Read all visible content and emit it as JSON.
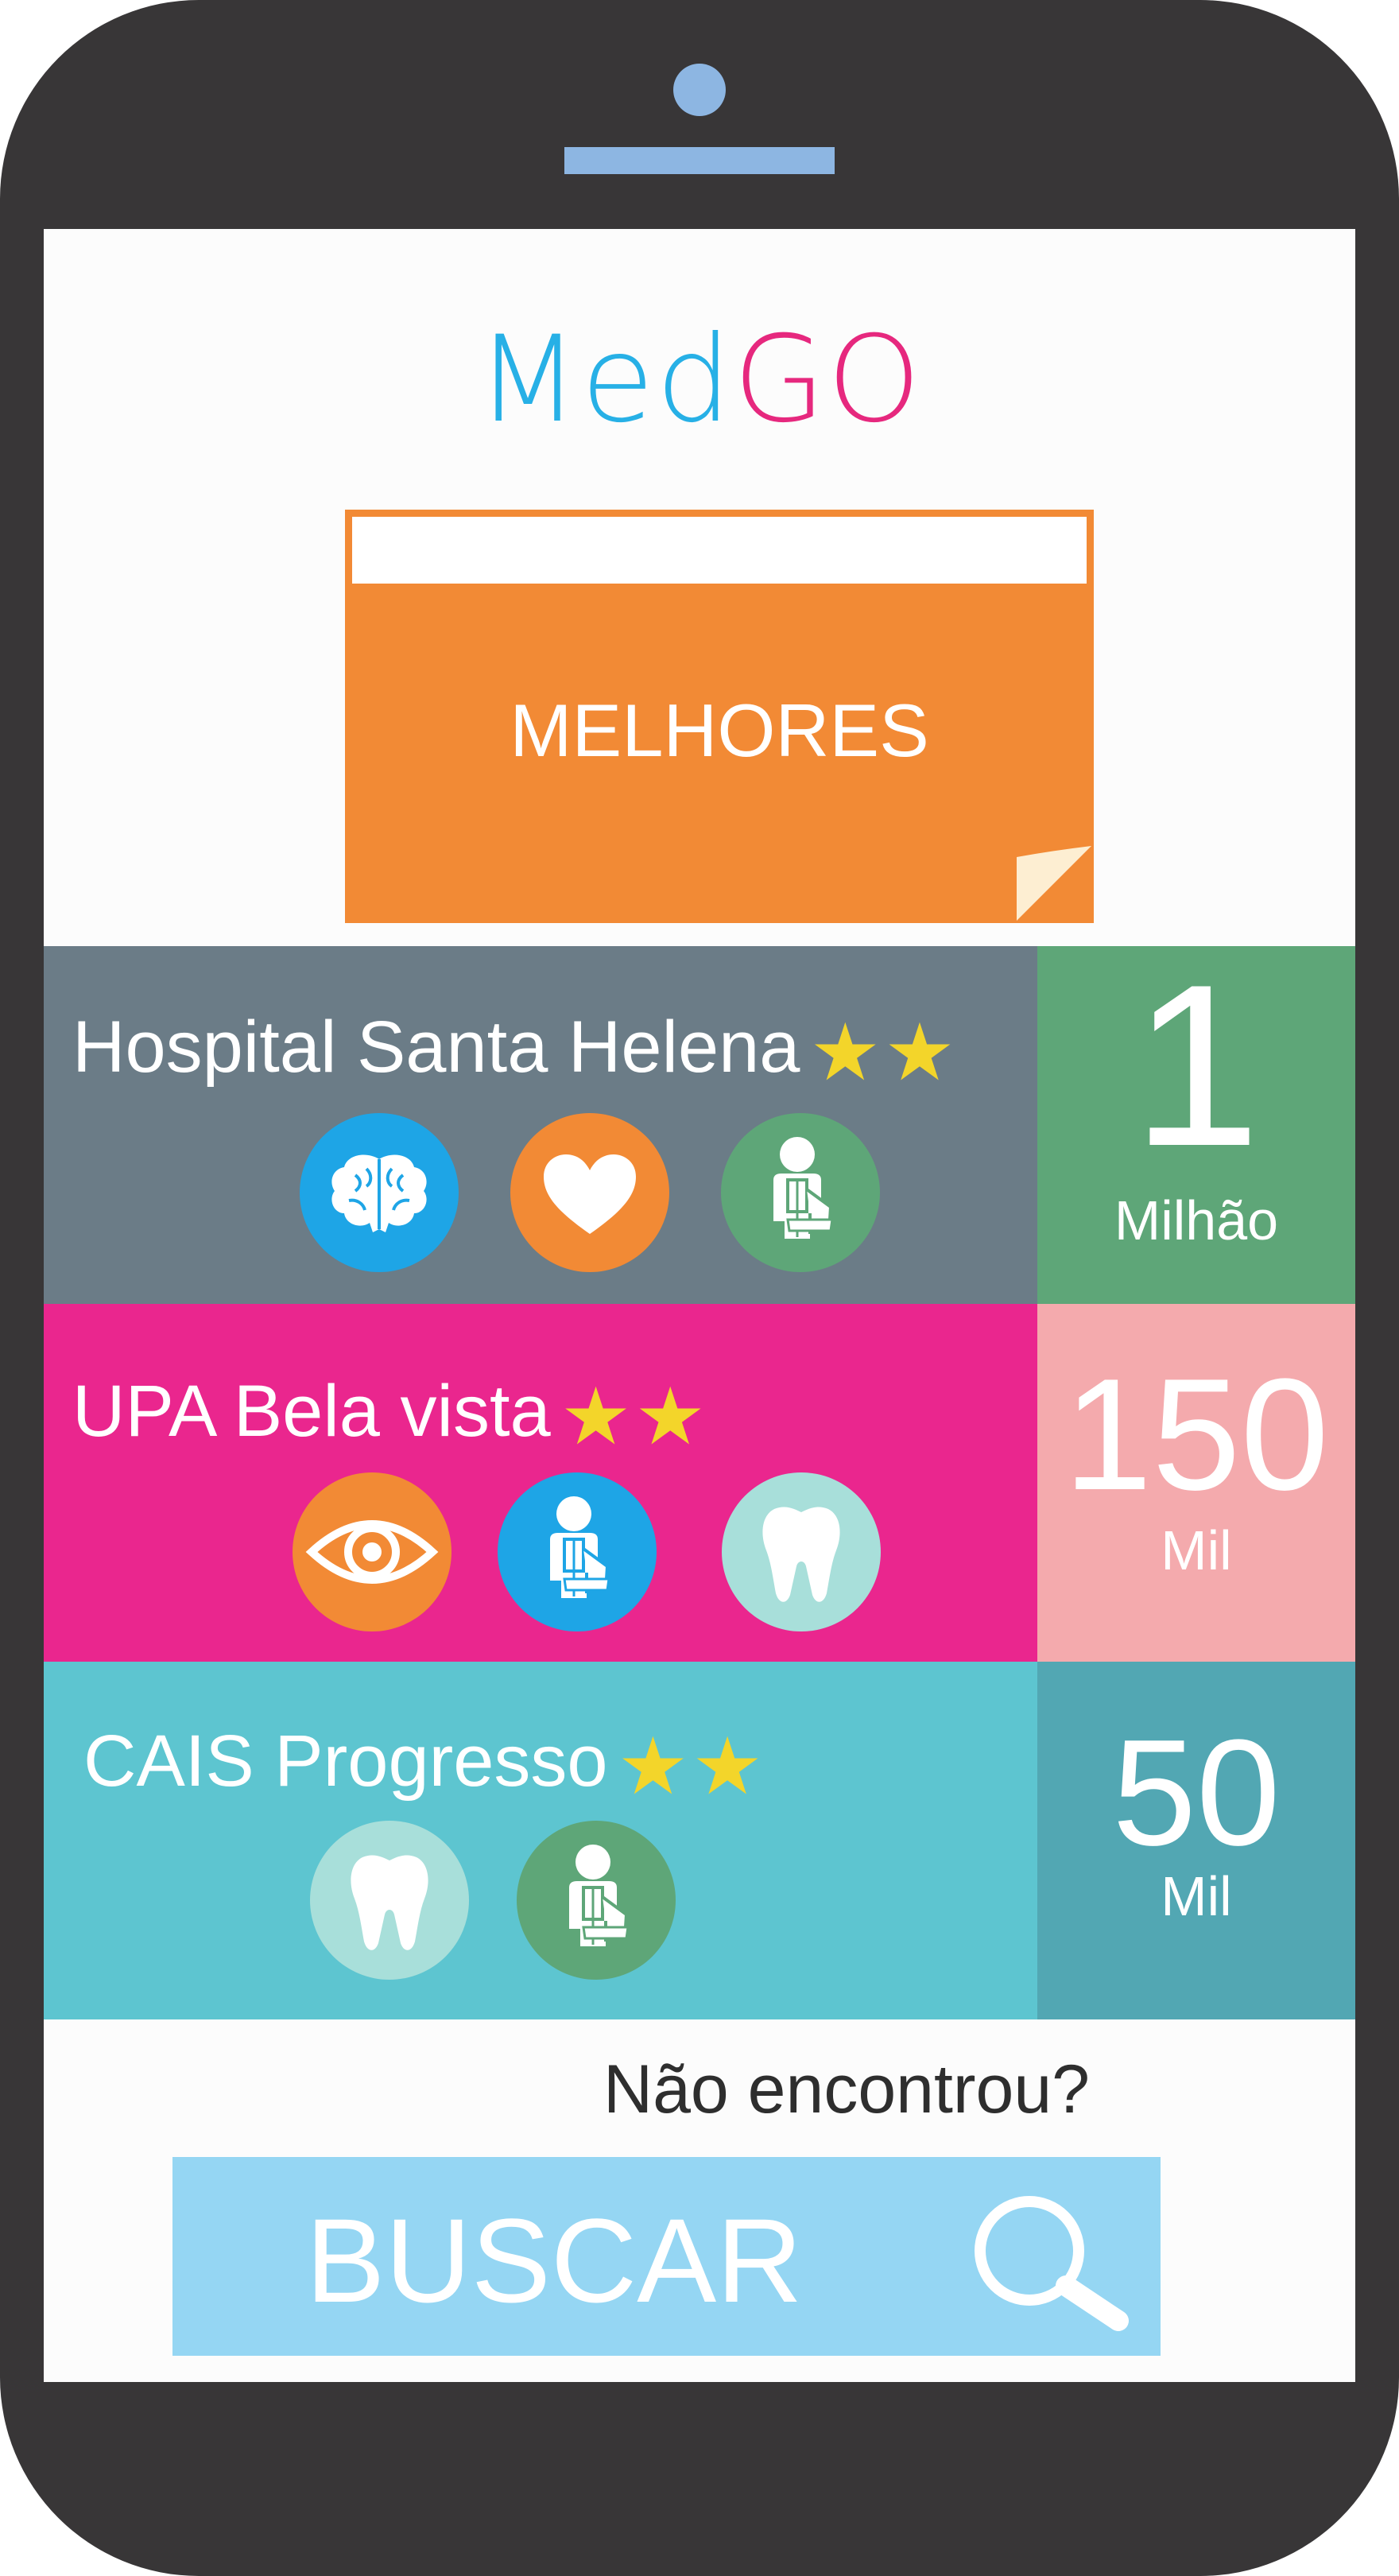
{
  "app": {
    "logo_part1": "Med",
    "logo_part2": "GO"
  },
  "header": {
    "title": "MELHORES"
  },
  "colors": {
    "accent_blue": "#27b0e6",
    "accent_pink": "#e6287e",
    "header_orange": "#f28a35"
  },
  "facilities": [
    {
      "name": "Hospital Santa Helena",
      "stars": "★★",
      "rating": 2,
      "icons": [
        "brain-icon",
        "heart-icon",
        "injured-patient-icon"
      ],
      "count_number": "1",
      "count_unit": "Milhão"
    },
    {
      "name": "UPA Bela vista",
      "stars": "★★",
      "rating": 2,
      "icons": [
        "eye-icon",
        "injured-patient-icon",
        "tooth-icon"
      ],
      "count_number": "150",
      "count_unit": "Mil"
    },
    {
      "name": "CAIS Progresso",
      "stars": "★★",
      "rating": 2,
      "icons": [
        "tooth-icon",
        "injured-patient-icon"
      ],
      "count_number": "50",
      "count_unit": "Mil"
    }
  ],
  "footer": {
    "prompt": "Não encontrou?",
    "search_label": "BUSCAR",
    "search_icon": "search-icon"
  }
}
